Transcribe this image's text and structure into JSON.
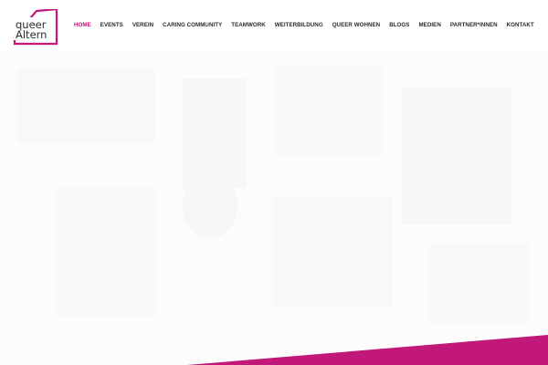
{
  "logo": {
    "line1": "queer",
    "line2": "Altern"
  },
  "nav": {
    "items": [
      {
        "label": "HOME",
        "active": true
      },
      {
        "label": "EVENTS",
        "active": false
      },
      {
        "label": "VEREIN",
        "active": false
      },
      {
        "label": "CARING COMMUNITY",
        "active": false
      },
      {
        "label": "TEAMWORK",
        "active": false
      },
      {
        "label": "WEITERBILDUNG",
        "active": false
      },
      {
        "label": "QUEER WOHNEN",
        "active": false
      },
      {
        "label": "BLOGS",
        "active": false
      },
      {
        "label": "MEDIEN",
        "active": false
      },
      {
        "label": "PARTNER*INNEN",
        "active": false
      },
      {
        "label": "KONTAKT",
        "active": false
      }
    ]
  },
  "colors": {
    "accent": "#c2187a",
    "text": "#2a2a2a",
    "hero_background": "#fcfcfc"
  }
}
